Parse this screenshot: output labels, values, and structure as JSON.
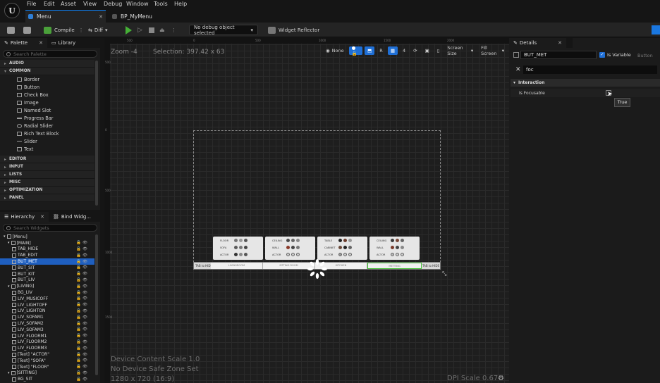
{
  "menu": [
    "File",
    "Edit",
    "Asset",
    "View",
    "Debug",
    "Window",
    "Tools",
    "Help"
  ],
  "logo": "U",
  "tabs": [
    {
      "label": "Menu"
    },
    {
      "label": "BP_MyMenu"
    }
  ],
  "toolbar": {
    "compile": "Compile",
    "diff": "Diff",
    "debug_select": "No debug object selected",
    "reflector": "Widget Reflector"
  },
  "palette": {
    "tab": "Palette",
    "library_tab": "Library",
    "search_placeholder": "Search Palette",
    "categories_top": [
      "AUDIO",
      "COMMON"
    ],
    "common_items": [
      "Border",
      "Button",
      "Check Box",
      "Image",
      "Named Slot",
      "Progress Bar",
      "Radial Slider",
      "Rich Text Block",
      "Slider",
      "Text"
    ],
    "categories_bottom": [
      "EDITOR",
      "INPUT",
      "LISTS",
      "MISC",
      "OPTIMIZATION",
      "PANEL"
    ]
  },
  "hierarchy": {
    "tab": "Hierarchy",
    "bind_tab": "Bind Widg...",
    "search_placeholder": "Search Widgets",
    "items": [
      {
        "label": "[Menu]",
        "indent": 0,
        "selected": false
      },
      {
        "label": "[MAIN]",
        "indent": 1,
        "selected": false
      },
      {
        "label": "TAB_HIDE",
        "indent": 2,
        "selected": false
      },
      {
        "label": "TAB_EDIT",
        "indent": 2,
        "selected": false
      },
      {
        "label": "BUT_MET",
        "indent": 2,
        "selected": true
      },
      {
        "label": "BUT_SIT",
        "indent": 2,
        "selected": false
      },
      {
        "label": "BUT_KIT",
        "indent": 2,
        "selected": false
      },
      {
        "label": "BUT_LIV",
        "indent": 2,
        "selected": false
      },
      {
        "label": "[LIVING]",
        "indent": 1,
        "selected": false
      },
      {
        "label": "BG_LIV",
        "indent": 2,
        "selected": false
      },
      {
        "label": "LIV_MUSICOFF",
        "indent": 2,
        "selected": false
      },
      {
        "label": "LIV_LIGHTOFF",
        "indent": 2,
        "selected": false
      },
      {
        "label": "LIV_LIGHTON",
        "indent": 2,
        "selected": false
      },
      {
        "label": "LIV_SOFAM1",
        "indent": 2,
        "selected": false
      },
      {
        "label": "LIV_SOFAM2",
        "indent": 2,
        "selected": false
      },
      {
        "label": "LIV_SOFAM3",
        "indent": 2,
        "selected": false
      },
      {
        "label": "LIV_FLOORM1",
        "indent": 2,
        "selected": false
      },
      {
        "label": "LIV_FLOORM2",
        "indent": 2,
        "selected": false
      },
      {
        "label": "LIV_FLOORM3",
        "indent": 2,
        "selected": false
      },
      {
        "label": "[Text] \"ACTOR\"",
        "indent": 2,
        "selected": false
      },
      {
        "label": "[Text] \"SOFA\"",
        "indent": 2,
        "selected": false
      },
      {
        "label": "[Text] \"FLOOR\"",
        "indent": 2,
        "selected": false
      },
      {
        "label": "[SITTING]",
        "indent": 1,
        "selected": false
      },
      {
        "label": "BG_SIT",
        "indent": 2,
        "selected": false
      }
    ]
  },
  "canvas": {
    "zoom": "Zoom -4",
    "selection": "Selection: 397.42 x 63",
    "ruler_top": [
      "500",
      "0",
      "500",
      "1000",
      "1500",
      "2000"
    ],
    "ruler_left": [
      "500",
      "0",
      "500",
      "1000",
      "1500"
    ],
    "none_label": "None",
    "r_label": "R",
    "grid_num": "4",
    "screen_size": "Screen Size",
    "fill_screen": "Fill Screen",
    "device_scale": "Device Content Scale 1.0",
    "safe_zone": "No Device Safe Zone Set",
    "resolution": "1280 x 720 (16:9)",
    "dpi": "DPI Scale 0.67",
    "tab_left": "TAB to HIDE",
    "tab_right": "TAB to HIDE",
    "tab_buttons": [
      "LIVINGROOM",
      "SITTING ROOM",
      "KITCHEN",
      "METTING"
    ],
    "cards": [
      {
        "rows": [
          "FLOOR",
          "SOFA",
          "ACTOR"
        ],
        "colors": [
          "#777777",
          "#5a5a5a",
          "#333333"
        ]
      },
      {
        "rows": [
          "CEILING",
          "WALL",
          "ACTOR"
        ],
        "colors": [
          "#4a4a4a",
          "#8a3a2a",
          "#cccccc"
        ]
      },
      {
        "rows": [
          "TABLE",
          "CABINET",
          "ACTOR"
        ],
        "colors": [
          "#222222",
          "#6b4a3a",
          "#999999"
        ]
      },
      {
        "rows": [
          "CEILING",
          "WALL",
          "ACTOR"
        ],
        "colors": [
          "#3a3a3a",
          "#7a3a2a",
          "#bbbbbb"
        ]
      }
    ]
  },
  "details": {
    "tab": "Details",
    "name": "BUT_MET",
    "is_variable": "Is Variable",
    "type": "Button",
    "search": "foc",
    "section": "Interaction",
    "property": "Is Focusable",
    "tooltip": "True"
  }
}
